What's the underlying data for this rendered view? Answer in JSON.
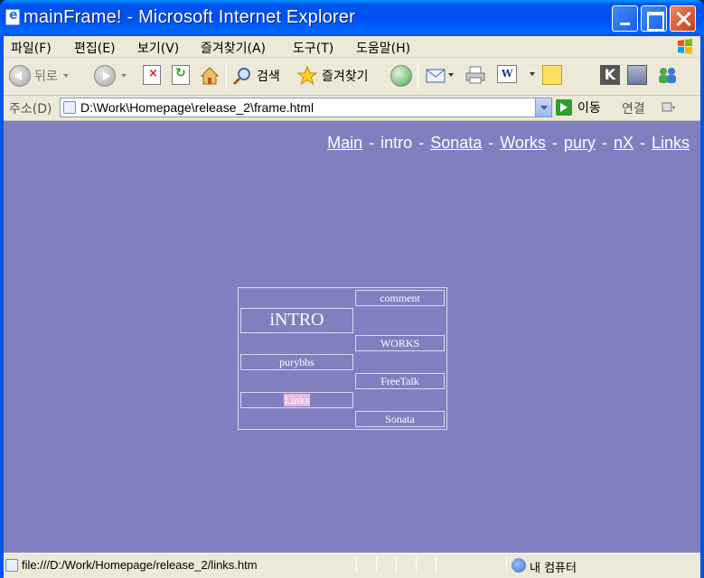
{
  "window": {
    "title": "mainFrame! - Microsoft Internet Explorer"
  },
  "menubar": {
    "items": [
      "파일(F)",
      "편집(E)",
      "보기(V)",
      "즐겨찾기(A)",
      "도구(T)",
      "도움말(H)"
    ]
  },
  "toolbar": {
    "back_label": "뒤로",
    "search_label": "검색",
    "favorites_label": "즐겨찾기"
  },
  "addressbar": {
    "label": "주소(D)",
    "url": "D:\\Work\\Homepage\\release_2\\frame.html",
    "go_label": "이동",
    "links_label": "연결"
  },
  "page": {
    "topnav": [
      "Main",
      "intro",
      "Sonata",
      "Works",
      "pury",
      "nX",
      "Links"
    ],
    "menu": {
      "comment": "comment",
      "intro": "iNTRO",
      "works": "WORKS",
      "purybbs": "purybbs",
      "freetalk": "FreeTalk",
      "links": "Links",
      "sonata": "Sonata"
    }
  },
  "statusbar": {
    "text": "file:///D:/Work/Homepage/release_2/links.htm",
    "zone": "내 컴퓨터"
  },
  "colors": {
    "page_bg": "#8080c0",
    "chrome_bg": "#ece9d8",
    "title_bar": "#0055e5",
    "link_highlight": "#e8b8e0"
  }
}
